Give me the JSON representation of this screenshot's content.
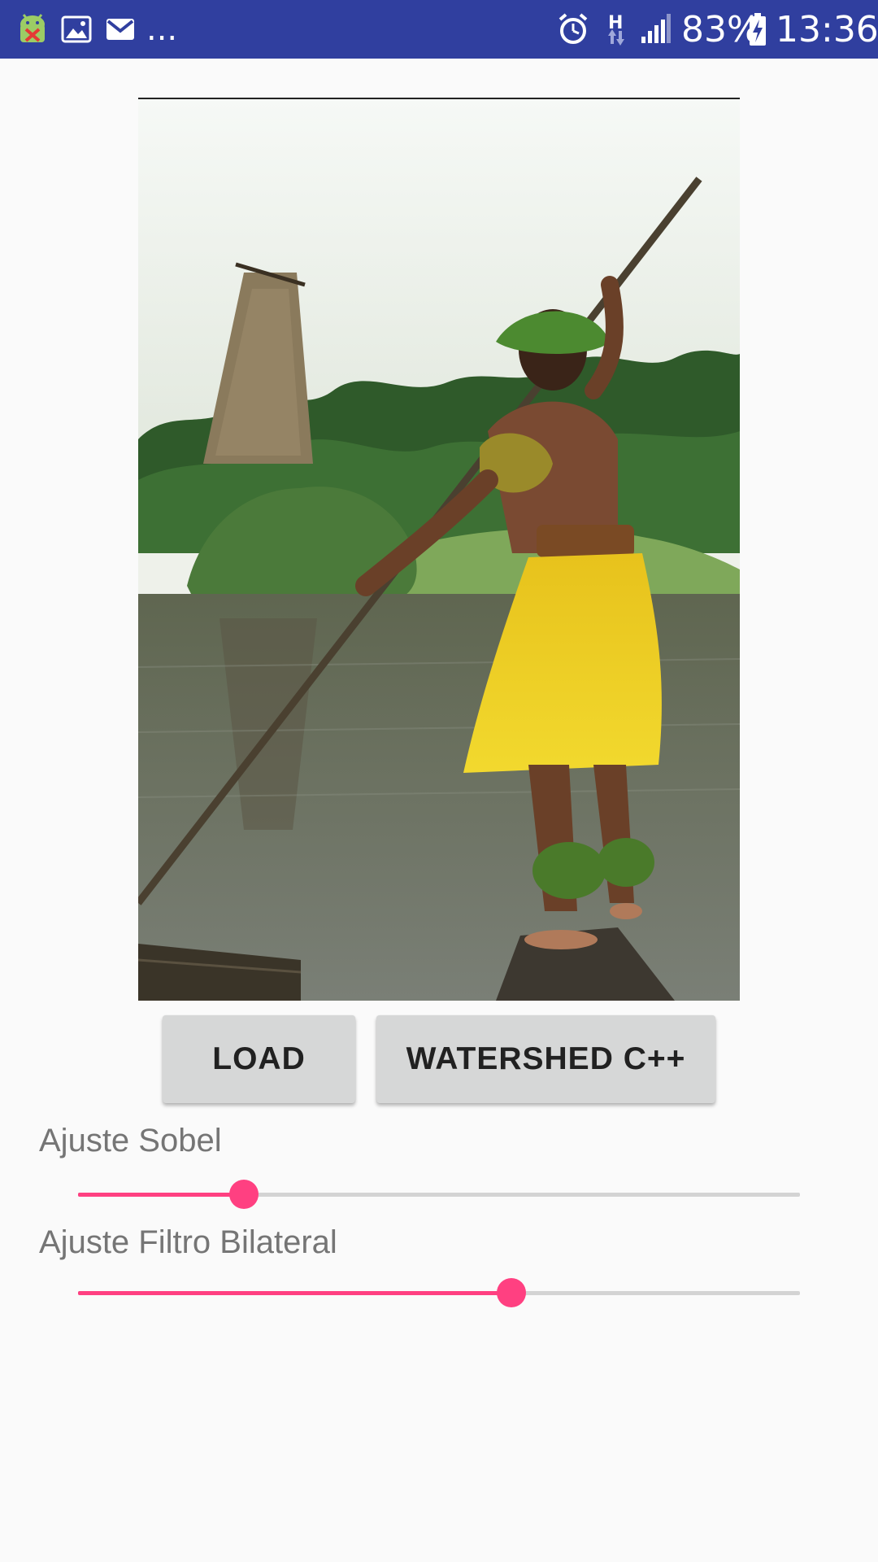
{
  "status_bar": {
    "notification_icons": [
      "android-debug-icon",
      "gallery-icon",
      "gmail-icon"
    ],
    "more_indicator": "...",
    "alarm_icon": "alarm-clock-icon",
    "network_type": "H",
    "signal_icon": "cellular-signal-icon",
    "battery_percent": "83%",
    "battery_icon": "battery-charging-icon",
    "time": "13:36"
  },
  "photo": {
    "icon": "loaded-photo"
  },
  "buttons": {
    "load_label": "LOAD",
    "watershed_label": "WATERSHED C++"
  },
  "sliders": {
    "sobel": {
      "label": "Ajuste Sobel",
      "value_fraction": 0.23
    },
    "bilateral": {
      "label": "Ajuste Filtro Bilateral",
      "value_fraction": 0.6
    }
  },
  "colors": {
    "status_bar": "#303f9f",
    "accent": "#ff4081",
    "button_bg": "#d6d7d7",
    "label_text": "#757575",
    "background": "#fafafa"
  }
}
